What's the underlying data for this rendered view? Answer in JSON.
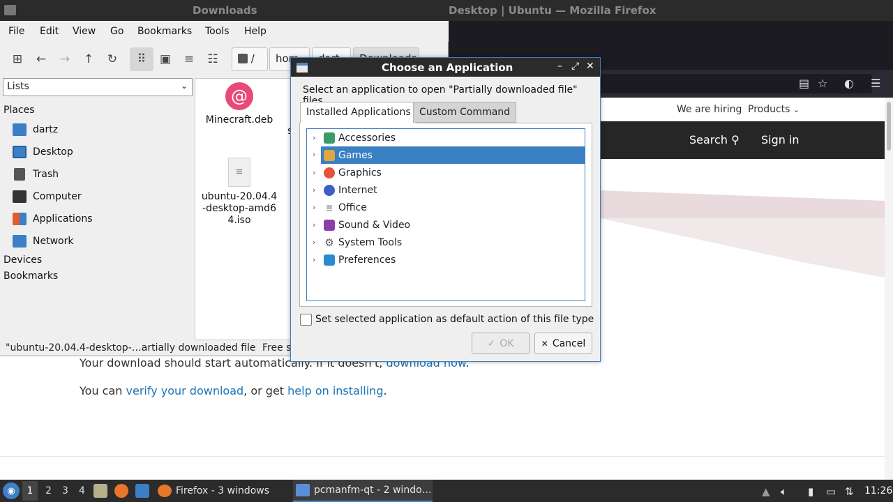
{
  "firefox": {
    "title": "Desktop | Ubuntu — Mozilla Firefox",
    "nav": {
      "hiring": "We are hiring",
      "products": "Products",
      "search": "Search",
      "signin": "Sign in"
    },
    "line1": {
      "pre": "Your download should start automatically. If it doesn't, ",
      "link": "download now",
      "post": "."
    },
    "line2": {
      "pre": "You can ",
      "link1": "verify your download",
      "mid": ", or get ",
      "link2": "help on installing",
      "post": "."
    }
  },
  "file_manager": {
    "title": "Downloads",
    "menu": [
      "File",
      "Edit",
      "View",
      "Go",
      "Bookmarks",
      "Tools",
      "Help"
    ],
    "path": {
      "root": "/",
      "seg1": "hom",
      "seg2": "dart",
      "seg3": "Downloads"
    },
    "side_pane_mode": "Lists",
    "sections": {
      "places": "Places",
      "devices": "Devices",
      "bookmarks": "Bookmarks"
    },
    "places": [
      {
        "label": "dartz",
        "icon": "home-folder-icon",
        "color": "#3b7fc4"
      },
      {
        "label": "Desktop",
        "icon": "desktop-icon",
        "color": "#3b7fc4"
      },
      {
        "label": "Trash",
        "icon": "trash-icon",
        "color": "#555555"
      },
      {
        "label": "Computer",
        "icon": "computer-icon",
        "color": "#333333"
      },
      {
        "label": "Applications",
        "icon": "applications-icon",
        "color": "#e25c2b"
      },
      {
        "label": "Network",
        "icon": "network-icon",
        "color": "#3b7fc4"
      }
    ],
    "files": [
      {
        "name": "Minecraft.deb",
        "icon": "debian-package-icon"
      },
      {
        "name": "ubuntu-20.04.4-desktop-amd64.iso",
        "icon": "file-icon"
      },
      {
        "name": "s",
        "icon": "file-icon"
      }
    ],
    "status_left": "\"ubuntu-20.04.4-desktop-…artially downloaded file",
    "status_right": "Free s"
  },
  "dialog": {
    "title": "Choose an Application",
    "prompt": "Select an application to open \"Partially downloaded file\" files",
    "tabs": [
      "Installed Applications",
      "Custom Command"
    ],
    "categories": [
      {
        "label": "Accessories",
        "icon": "accessories-icon",
        "color": "#3a9a6a",
        "selected": false
      },
      {
        "label": "Games",
        "icon": "games-icon",
        "color": "#e0a640",
        "selected": true
      },
      {
        "label": "Graphics",
        "icon": "graphics-icon",
        "color": "#e8513b",
        "selected": false
      },
      {
        "label": "Internet",
        "icon": "internet-icon",
        "color": "#3b5fc4",
        "selected": false
      },
      {
        "label": "Office",
        "icon": "office-icon",
        "color": "#777777",
        "selected": false
      },
      {
        "label": "Sound & Video",
        "icon": "sound-video-icon",
        "color": "#8a3fa8",
        "selected": false
      },
      {
        "label": "System Tools",
        "icon": "system-tools-icon",
        "color": "#555555",
        "selected": false
      },
      {
        "label": "Preferences",
        "icon": "preferences-icon",
        "color": "#2a8ad0",
        "selected": false
      }
    ],
    "default_checkbox": "Set selected application as default action of this file type",
    "ok": "OK",
    "cancel": "Cancel"
  },
  "taskbar": {
    "workspaces": [
      "1",
      "2",
      "3",
      "4"
    ],
    "tasks": [
      "Firefox - 3 windows",
      "pcmanfm-qt - 2 windo…"
    ],
    "clock": "11:26"
  }
}
